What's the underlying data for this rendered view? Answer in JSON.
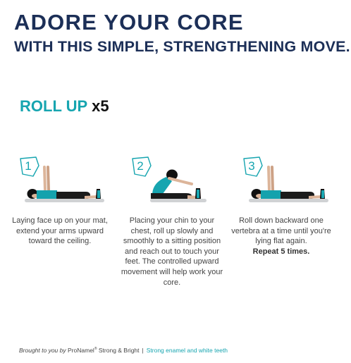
{
  "header": {
    "title": "ADORE YOUR CORE",
    "subtitle": "WITH THIS SIMPLE, STRENGTHENING MOVE."
  },
  "move": {
    "name": "ROLL UP",
    "reps": "x5"
  },
  "steps": [
    {
      "number": "1",
      "text": "Laying face up on your mat, extend your arms upward toward the ceiling.",
      "emphasis": ""
    },
    {
      "number": "2",
      "text": "Placing your chin to your chest, roll up slowly and smoothly to a sitting position and reach out to touch your feet. The controlled upward movement will help work your core.",
      "emphasis": ""
    },
    {
      "number": "3",
      "text": "Roll down backward one vertebra at a time until you're lying flat again.",
      "emphasis": "Repeat 5 times."
    }
  ],
  "footer": {
    "brought_by": "Brought to you by",
    "brand": "ProNamel",
    "reg": "®",
    "product": "Strong & Bright",
    "separator": "|",
    "tagline": "Strong enamel and white teeth"
  },
  "colors": {
    "navy": "#1c2f57",
    "teal": "#17a5b0",
    "text": "#444444"
  }
}
